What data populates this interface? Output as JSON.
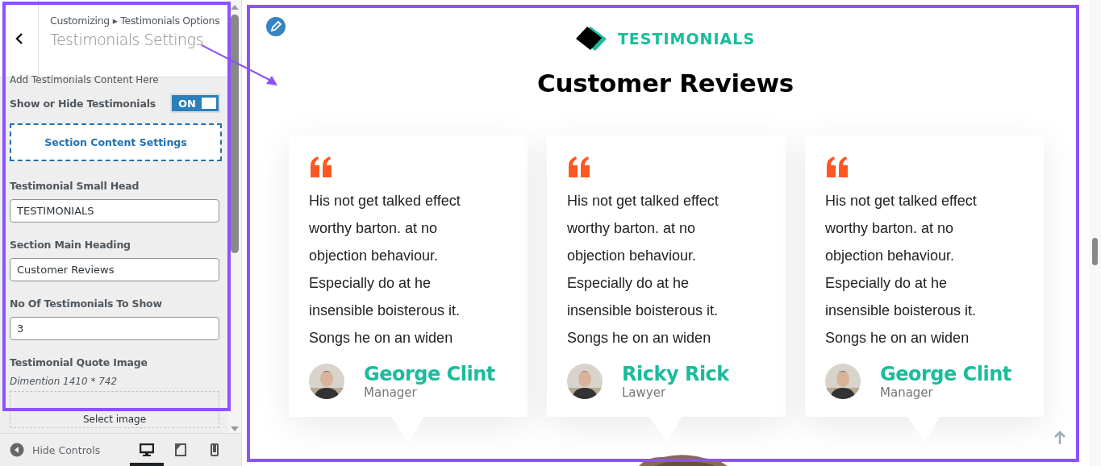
{
  "sidebar": {
    "breadcrumb": "Customizing ▸ Testimonials Options",
    "title": "Testimonials Settings",
    "description": "Add Testimonials Content Here",
    "toggle": {
      "label": "Show or Hide Testimonials",
      "on": true,
      "text": "ON"
    },
    "section_button": "Section Content Settings",
    "fields": [
      {
        "label": "Testimonial Small Head",
        "value": "TESTIMONIALS"
      },
      {
        "label": "Section Main Heading",
        "value": "Customer Reviews"
      },
      {
        "label": "No Of Testimonials To Show",
        "value": "3"
      }
    ],
    "quote_image": {
      "label": "Testimonial Quote Image",
      "hint": "Dimention 1410 * 742",
      "button": "Select image"
    },
    "footer": {
      "hide_controls": "Hide Controls",
      "devices": [
        {
          "kind": "desktop",
          "selected": true
        },
        {
          "kind": "tablet",
          "selected": false
        },
        {
          "kind": "mobile",
          "selected": false
        }
      ]
    }
  },
  "preview": {
    "small_head": "TESTIMONIALS",
    "heading": "Customer Reviews",
    "cards": [
      {
        "quote": "His not get talked effect worthy barton. at no objection behaviour. Especially do at he insensible boisterous it. Songs he on an widen",
        "name": "George Clint",
        "role": "Manager"
      },
      {
        "quote": "His not get talked effect worthy barton. at no objection behaviour. Especially do at he insensible boisterous it. Songs he on an widen",
        "name": "Ricky Rick",
        "role": "Lawyer"
      },
      {
        "quote": "His not get talked effect worthy barton. at no objection behaviour. Especially do at he insensible boisterous it. Songs he on an widen",
        "name": "George Clint",
        "role": "Manager"
      }
    ]
  }
}
